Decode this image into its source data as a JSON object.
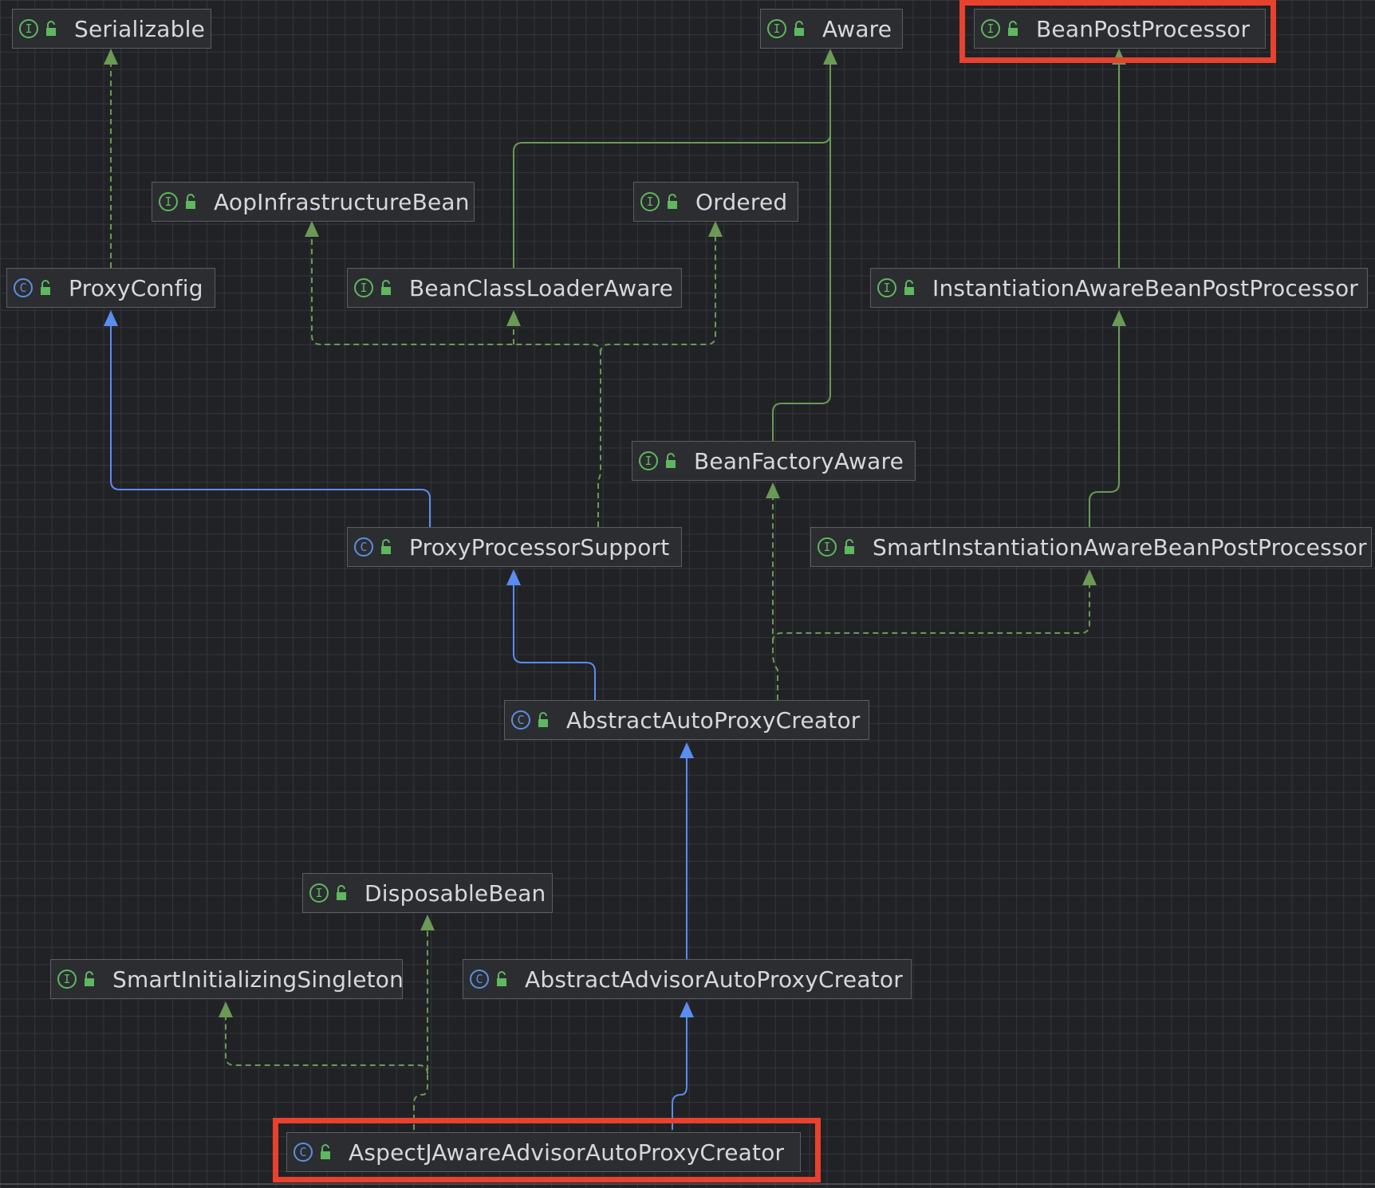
{
  "diagram": {
    "nodes": {
      "serializable": {
        "label": "Serializable",
        "kind": "I"
      },
      "aware": {
        "label": "Aware",
        "kind": "I"
      },
      "bean_post_processor": {
        "label": "BeanPostProcessor",
        "kind": "I"
      },
      "aop_infrastructure_bean": {
        "label": "AopInfrastructureBean",
        "kind": "I"
      },
      "ordered": {
        "label": "Ordered",
        "kind": "I"
      },
      "proxy_config": {
        "label": "ProxyConfig",
        "kind": "C"
      },
      "bean_class_loader_aware": {
        "label": "BeanClassLoaderAware",
        "kind": "I"
      },
      "instantiation_aware_bpp": {
        "label": "InstantiationAwareBeanPostProcessor",
        "kind": "I"
      },
      "bean_factory_aware": {
        "label": "BeanFactoryAware",
        "kind": "I"
      },
      "proxy_processor_support": {
        "label": "ProxyProcessorSupport",
        "kind": "C"
      },
      "smart_instantiation_aware_bpp": {
        "label": "SmartInstantiationAwareBeanPostProcessor",
        "kind": "I"
      },
      "abstract_auto_proxy_creator": {
        "label": "AbstractAutoProxyCreator",
        "kind": "C"
      },
      "disposable_bean": {
        "label": "DisposableBean",
        "kind": "I"
      },
      "smart_initializing_singleton": {
        "label": "SmartInitializingSingleton",
        "kind": "I"
      },
      "abstract_advisor_auto_proxy_creator": {
        "label": "AbstractAdvisorAutoProxyCreator",
        "kind": "C"
      },
      "aspectj_aware_advisor_auto_proxy_creator": {
        "label": "AspectJAwareAdvisorAutoProxyCreator",
        "kind": "C"
      }
    },
    "edges": [
      {
        "from": "proxy_config",
        "to": "serializable",
        "type": "implements"
      },
      {
        "from": "bean_class_loader_aware",
        "to": "aware",
        "type": "extends"
      },
      {
        "from": "bean_factory_aware",
        "to": "aware",
        "type": "extends"
      },
      {
        "from": "instantiation_aware_bpp",
        "to": "bean_post_processor",
        "type": "extends"
      },
      {
        "from": "smart_instantiation_aware_bpp",
        "to": "instantiation_aware_bpp",
        "type": "extends"
      },
      {
        "from": "proxy_processor_support",
        "to": "proxy_config",
        "type": "inherits"
      },
      {
        "from": "proxy_processor_support",
        "to": "aop_infrastructure_bean",
        "type": "implements"
      },
      {
        "from": "proxy_processor_support",
        "to": "bean_class_loader_aware",
        "type": "implements"
      },
      {
        "from": "proxy_processor_support",
        "to": "ordered",
        "type": "implements"
      },
      {
        "from": "abstract_auto_proxy_creator",
        "to": "proxy_processor_support",
        "type": "inherits"
      },
      {
        "from": "abstract_auto_proxy_creator",
        "to": "bean_factory_aware",
        "type": "implements"
      },
      {
        "from": "abstract_auto_proxy_creator",
        "to": "smart_instantiation_aware_bpp",
        "type": "implements"
      },
      {
        "from": "abstract_advisor_auto_proxy_creator",
        "to": "abstract_auto_proxy_creator",
        "type": "inherits"
      },
      {
        "from": "aspectj_aware_advisor_auto_proxy_creator",
        "to": "abstract_advisor_auto_proxy_creator",
        "type": "inherits"
      },
      {
        "from": "aspectj_aware_advisor_auto_proxy_creator",
        "to": "disposable_bean",
        "type": "implements"
      },
      {
        "from": "aspectj_aware_advisor_auto_proxy_creator",
        "to": "smart_initializing_singleton",
        "type": "implements"
      }
    ],
    "highlighted": [
      "bean_post_processor",
      "aspectj_aware_advisor_auto_proxy_creator"
    ],
    "colors": {
      "background": "#212226",
      "grid": "#34363b",
      "node_fill": "#2b2d30",
      "node_border": "#5b5e63",
      "text": "#d5d8dc",
      "interface_icon": "#5fb85f",
      "class_icon": "#5d8fdf",
      "edge_interface": "#6a9a55",
      "edge_class": "#5b8def",
      "highlight": "#e8412e"
    }
  }
}
